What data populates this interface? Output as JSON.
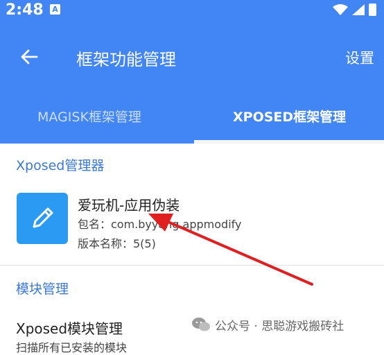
{
  "status_bar": {
    "time": "2:48",
    "notif_glyph": "A"
  },
  "appbar": {
    "title": "框架功能管理",
    "settings_label": "设置"
  },
  "tabs": [
    {
      "label": "MAGISK框架管理",
      "selected": false
    },
    {
      "label": "XPOSED框架管理",
      "selected": true
    }
  ],
  "colors": {
    "primary": "#4285f4",
    "section": "#3b78d8",
    "arrow": "#e02020",
    "icon_bg": "#2b9af3"
  },
  "xposed_manager": {
    "header": "Xposed管理器",
    "app": {
      "name": "爱玩机-应用伪装",
      "package_line": "包名：com.byyang.appmodify",
      "version_line": "版本名称：5(5)",
      "icon": "pencil-icon"
    }
  },
  "modules": {
    "header": "模块管理",
    "item": {
      "title": "Xposed模块管理",
      "subtitle": "扫描所有已安装的模块"
    }
  },
  "watermark": {
    "text": "公众号 · 思聪游戏搬砖社"
  }
}
